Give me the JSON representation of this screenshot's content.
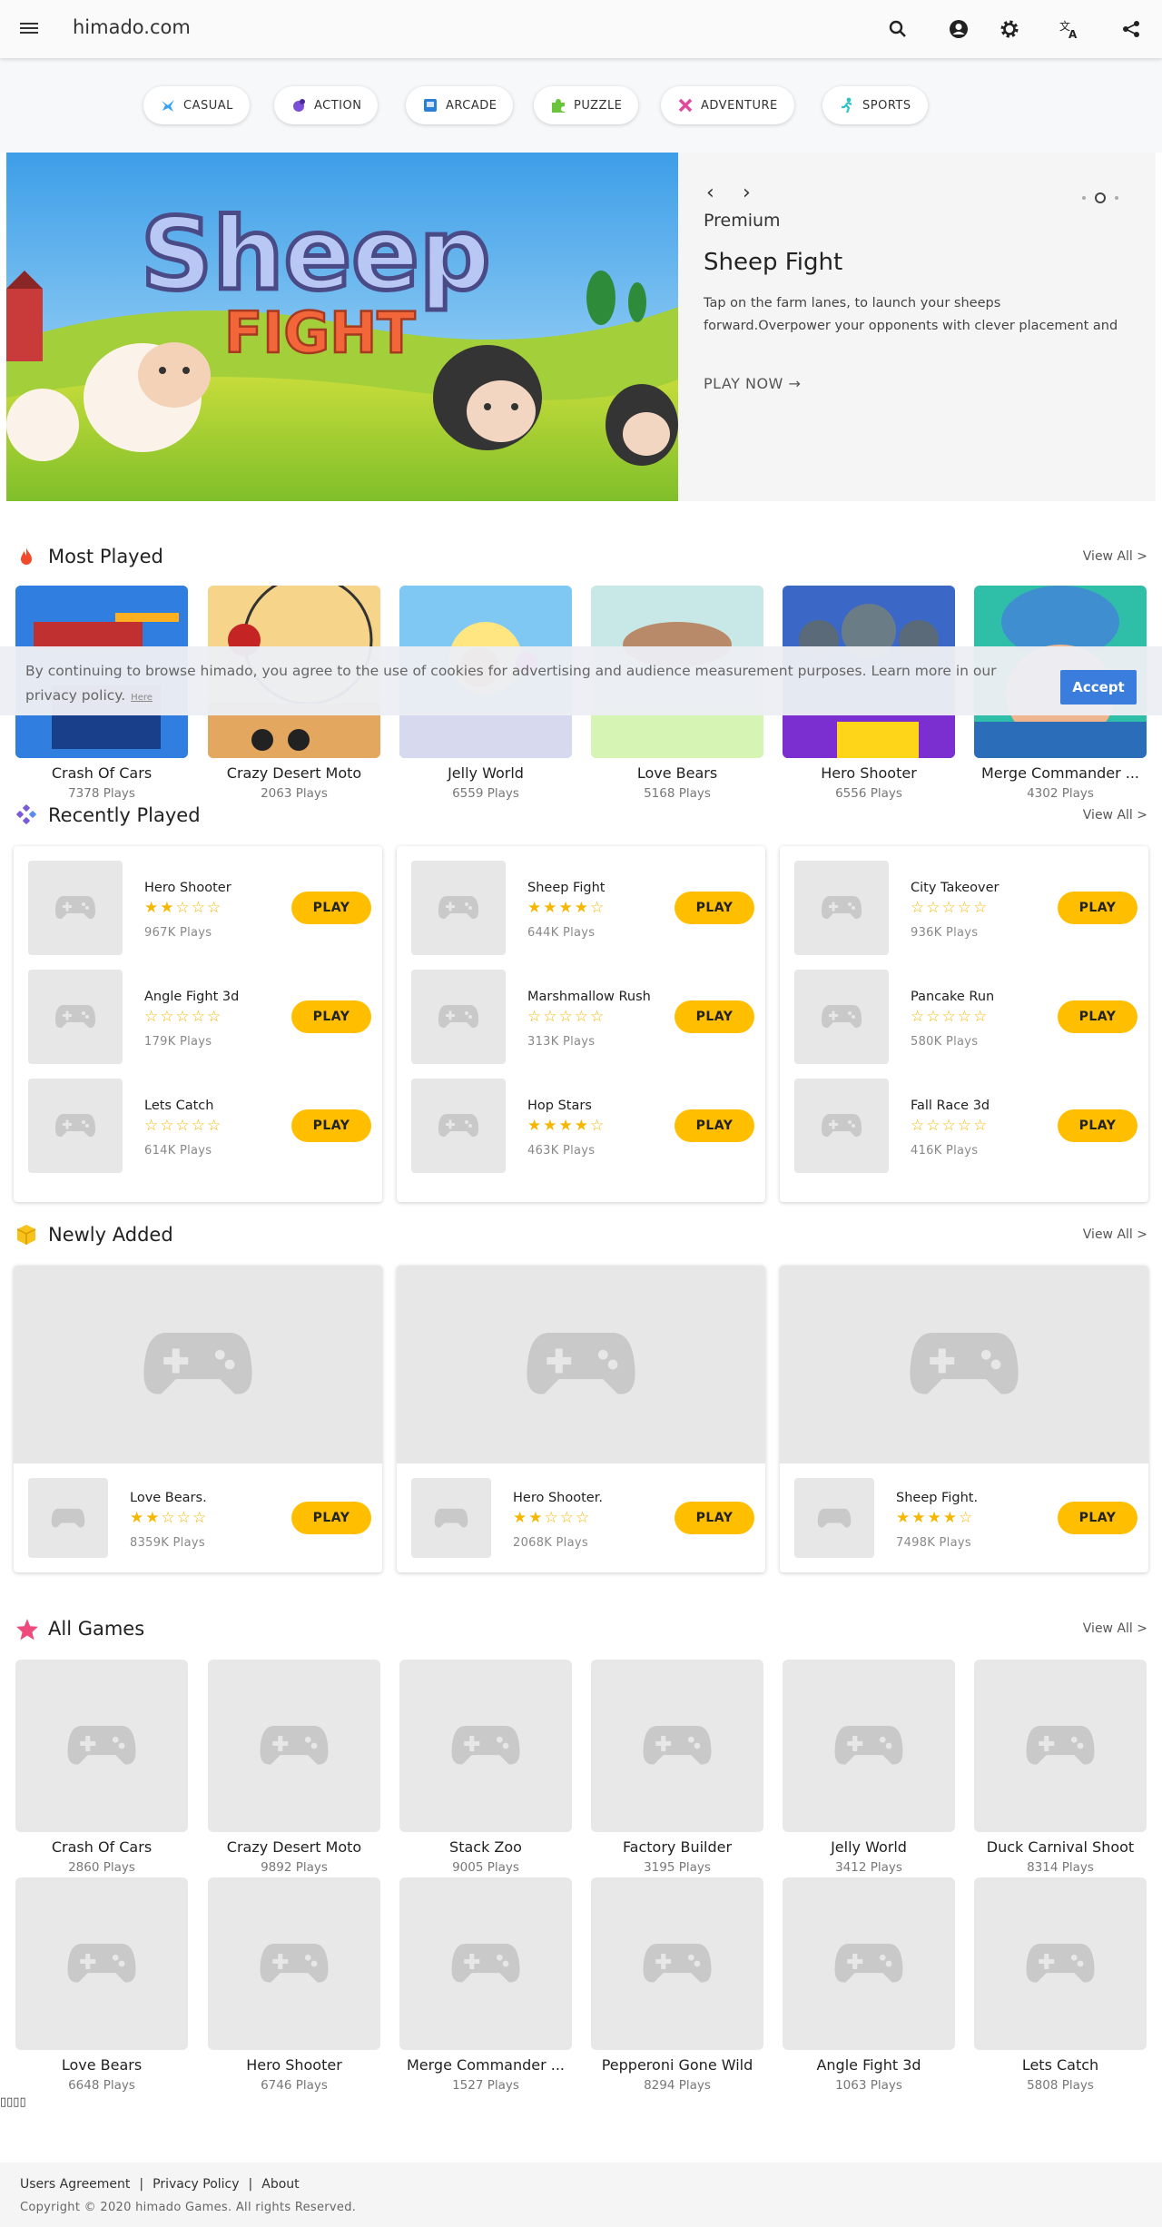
{
  "header": {
    "logo": "himado.com"
  },
  "categories": [
    {
      "label": "CASUAL",
      "icon": "casual-icon",
      "color": "#3aa0f0"
    },
    {
      "label": "ACTION",
      "icon": "action-icon",
      "color": "#7b4fd6"
    },
    {
      "label": "ARCADE",
      "icon": "arcade-icon",
      "color": "#2a7fd8"
    },
    {
      "label": "PUZZLE",
      "icon": "puzzle-icon",
      "color": "#6cc43c"
    },
    {
      "label": "ADVENTURE",
      "icon": "adventure-icon",
      "color": "#e04a9c"
    },
    {
      "label": "SPORTS",
      "icon": "sports-icon",
      "color": "#2ec4c4"
    }
  ],
  "carousel": {
    "label": "Premium",
    "title": "Sheep Fight",
    "description": "Tap on the farm lanes, to launch your sheeps forward.Overpower your opponents with clever placement and timing to push them back and score points.",
    "cta": "PLAY NOW",
    "arrow": "→",
    "hero_title_line1": "Sheep",
    "hero_title_line2": "FIGHT"
  },
  "most_played": {
    "title": "Most Played",
    "view_all": "View All >",
    "items": [
      {
        "name": "Crash Of Cars",
        "plays": "7378 Plays"
      },
      {
        "name": "Crazy Desert Moto",
        "plays": "2063 Plays"
      },
      {
        "name": "Jelly World",
        "plays": "6559 Plays"
      },
      {
        "name": "Love Bears",
        "plays": "5168 Plays"
      },
      {
        "name": "Hero Shooter",
        "plays": "6556 Plays"
      },
      {
        "name": "Merge Commander ...",
        "plays": "4302 Plays"
      }
    ]
  },
  "cookie": {
    "text": "By continuing to browse himado, you agree to the use of cookies for advertising and audience measurement purposes. Learn more in our privacy policy.",
    "here": "Here",
    "accept": "Accept"
  },
  "recently_played": {
    "title": "Recently Played",
    "view_all": "View All >",
    "play_label": "PLAY",
    "columns": [
      [
        {
          "name": "Hero Shooter",
          "stars": "★★☆☆☆",
          "plays": "967K Plays"
        },
        {
          "name": "Angle Fight 3d",
          "stars": "☆☆☆☆☆",
          "plays": "179K Plays"
        },
        {
          "name": "Lets Catch",
          "stars": "☆☆☆☆☆",
          "plays": "614K Plays"
        }
      ],
      [
        {
          "name": "Sheep Fight",
          "stars": "★★★★☆",
          "plays": "644K Plays"
        },
        {
          "name": "Marshmallow Rush",
          "stars": "☆☆☆☆☆",
          "plays": "313K Plays"
        },
        {
          "name": "Hop Stars",
          "stars": "★★★★☆",
          "plays": "463K Plays"
        }
      ],
      [
        {
          "name": "City Takeover",
          "stars": "☆☆☆☆☆",
          "plays": "936K Plays"
        },
        {
          "name": "Pancake Run",
          "stars": "☆☆☆☆☆",
          "plays": "580K Plays"
        },
        {
          "name": "Fall Race 3d",
          "stars": "☆☆☆☆☆",
          "plays": "416K Plays"
        }
      ]
    ]
  },
  "newly_added": {
    "title": "Newly Added",
    "view_all": "View All >",
    "play_label": "PLAY",
    "items": [
      {
        "name": "Love Bears.",
        "stars": "★★☆☆☆",
        "plays": "8359K Plays"
      },
      {
        "name": "Hero Shooter.",
        "stars": "★★☆☆☆",
        "plays": "2068K Plays"
      },
      {
        "name": "Sheep Fight.",
        "stars": "★★★★☆",
        "plays": "7498K Plays"
      }
    ]
  },
  "all_games": {
    "title": "All Games",
    "view_all": "View All >",
    "items": [
      {
        "name": "Crash Of Cars",
        "plays": "2860 Plays"
      },
      {
        "name": "Crazy Desert Moto",
        "plays": "9892 Plays"
      },
      {
        "name": "Stack Zoo",
        "plays": "9005 Plays"
      },
      {
        "name": "Factory Builder",
        "plays": "3195 Plays"
      },
      {
        "name": "Jelly World",
        "plays": "3412 Plays"
      },
      {
        "name": "Duck Carnival Shoot",
        "plays": "8314 Plays"
      },
      {
        "name": "Love Bears",
        "plays": "6648 Plays"
      },
      {
        "name": "Hero Shooter",
        "plays": "6746 Plays"
      },
      {
        "name": "Merge Commander ...",
        "plays": "1527 Plays"
      },
      {
        "name": "Pepperoni Gone Wild",
        "plays": "8294 Plays"
      },
      {
        "name": "Angle Fight 3d",
        "plays": "1063 Plays"
      },
      {
        "name": "Lets Catch",
        "plays": "5808 Plays"
      }
    ]
  },
  "stray_text": "▯▯▯▯",
  "footer": {
    "links": [
      "Users Agreement",
      "Privacy Policy",
      "About"
    ],
    "separator": "|",
    "copyright": "Copyright © 2020 himado Games. All rights Reserved."
  },
  "colors": {
    "accent": "#ffbf00",
    "accept": "#3b7ddd",
    "star": "#f5b700"
  }
}
